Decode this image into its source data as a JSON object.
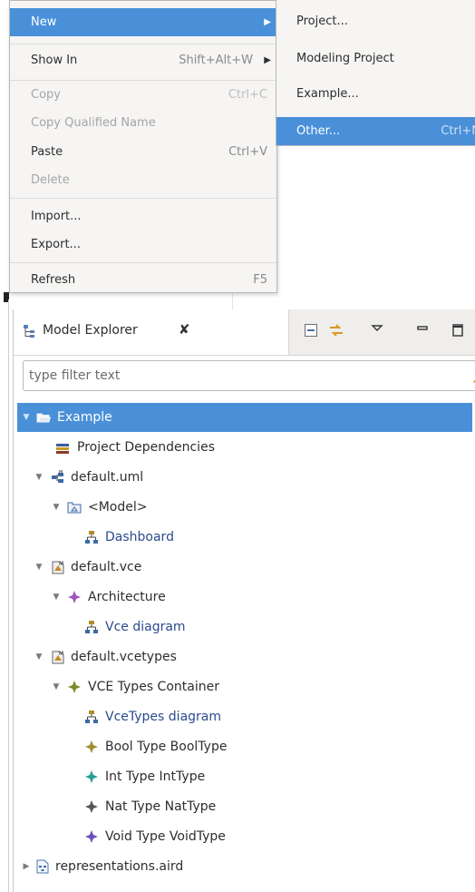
{
  "context_menu": {
    "items": [
      {
        "label": "New",
        "accel": "",
        "submenu": true,
        "disabled": false,
        "active": true
      },
      {
        "label": "Show In",
        "accel": "Shift+Alt+W",
        "submenu": true,
        "disabled": false,
        "active": false
      },
      {
        "label": "Copy",
        "accel": "Ctrl+C",
        "submenu": false,
        "disabled": true,
        "active": false
      },
      {
        "label": "Copy Qualified Name",
        "accel": "",
        "submenu": false,
        "disabled": true,
        "active": false
      },
      {
        "label": "Paste",
        "accel": "Ctrl+V",
        "submenu": false,
        "disabled": false,
        "active": false
      },
      {
        "label": "Delete",
        "accel": "",
        "submenu": false,
        "disabled": true,
        "active": false
      },
      {
        "label": "Import...",
        "accel": "",
        "submenu": false,
        "disabled": false,
        "active": false
      },
      {
        "label": "Export...",
        "accel": "",
        "submenu": false,
        "disabled": false,
        "active": false
      },
      {
        "label": "Refresh",
        "accel": "F5",
        "submenu": false,
        "disabled": false,
        "active": false
      }
    ]
  },
  "new_submenu": {
    "items": [
      {
        "label": "Project...",
        "accel": ""
      },
      {
        "label": "Modeling Project",
        "accel": ""
      },
      {
        "label": "Example...",
        "accel": ""
      },
      {
        "label": "Other...",
        "accel": "Ctrl+N"
      }
    ]
  },
  "view": {
    "title": "Model Explorer",
    "close_glyph": "✘",
    "filter_placeholder": "type filter text"
  },
  "tree": [
    {
      "label": "Example",
      "icon": "open-project-icon",
      "twisty": "expanded",
      "selected": true,
      "link": false
    },
    {
      "label": "Project Dependencies",
      "icon": "library-icon",
      "twisty": "none",
      "selected": false,
      "link": false
    },
    {
      "label": "default.uml",
      "icon": "uml-model-icon",
      "twisty": "expanded",
      "selected": false,
      "link": false
    },
    {
      "label": "<Model>",
      "icon": "package-icon",
      "twisty": "expanded",
      "selected": false,
      "link": false
    },
    {
      "label": "Dashboard",
      "icon": "diagram-icon",
      "twisty": "none",
      "selected": false,
      "link": true
    },
    {
      "label": "default.vce",
      "icon": "model-file-icon",
      "twisty": "expanded",
      "selected": false,
      "link": false
    },
    {
      "label": "Architecture",
      "icon": "element-icon",
      "twisty": "expanded",
      "selected": false,
      "link": false
    },
    {
      "label": "Vce diagram",
      "icon": "diagram-icon",
      "twisty": "none",
      "selected": false,
      "link": true
    },
    {
      "label": "default.vcetypes",
      "icon": "model-file-icon",
      "twisty": "expanded",
      "selected": false,
      "link": false
    },
    {
      "label": "VCE Types Container",
      "icon": "element-icon",
      "twisty": "expanded",
      "selected": false,
      "link": false
    },
    {
      "label": "VceTypes diagram",
      "icon": "diagram-icon",
      "twisty": "none",
      "selected": false,
      "link": true
    },
    {
      "label": "Bool Type BoolType",
      "icon": "element-icon",
      "twisty": "none",
      "selected": false,
      "link": false
    },
    {
      "label": "Int Type IntType",
      "icon": "element-icon",
      "twisty": "none",
      "selected": false,
      "link": false
    },
    {
      "label": "Nat Type NatType",
      "icon": "element-icon",
      "twisty": "none",
      "selected": false,
      "link": false
    },
    {
      "label": "Void Type VoidType",
      "icon": "element-icon",
      "twisty": "none",
      "selected": false,
      "link": false
    },
    {
      "label": "representations.aird",
      "icon": "aird-file-icon",
      "twisty": "collapsed",
      "selected": false,
      "link": false
    }
  ],
  "colors": {
    "selection": "#4a90d9",
    "link_text": "#2b4b8c",
    "element_purple": "#9b59b6",
    "element_olive": "#7a8a2a",
    "element_khaki": "#a0902c",
    "element_teal": "#2a9d9a",
    "element_dark": "#555555",
    "element_violet": "#6a4fc0"
  }
}
